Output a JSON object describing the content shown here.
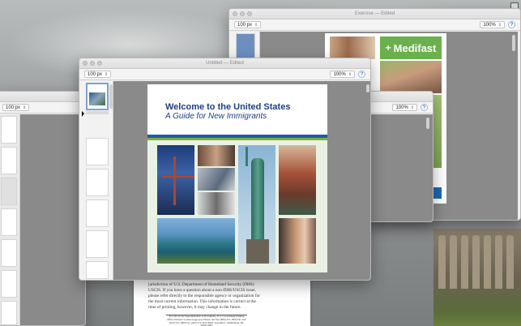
{
  "colors": {
    "booklet_blue": "#1e3f87",
    "booklet_green": "#7fae3b",
    "medifast_green": "#6ab04c"
  },
  "windows": {
    "back_right": {
      "title": "Exercise — Edited",
      "size_value": "100 px",
      "zoom_value": "100%",
      "help_icon": "?"
    },
    "back_left": {
      "size_value": "100 px"
    },
    "mid_right": {
      "zoom_value": "100%",
      "help_icon": "?"
    },
    "main": {
      "title": "Untitled — Edited",
      "size_value": "100 px",
      "zoom_value": "100%",
      "help_icon": "?",
      "booklet": {
        "title": "Welcome to the United States",
        "subtitle": "A Guide for New Immigrants"
      }
    }
  },
  "medifast": {
    "brand": "Medifast",
    "mark": "+"
  },
  "bottom_doc": {
    "paragraph": "jurisdiction of U.S. Department of Homeland Security (DHS) USCIS. If you have a question about a non-DHS/USCIS issue, please refer directly to the responsible agency or organization for the most current information. This information is correct at the time of printing, however, it may change in the future.",
    "footer": "For sale by the Superintendent of Documents, U.S. Government Printing Office Internet: bookstore.gpo.gov Phone: toll free (866) 512-1800; DC area (202) 512-1800 Fax: (202) 512-2104 Mail: Stop IDCC, Washington, DC 20402-0001"
  },
  "menubar_icon": "window-icon"
}
